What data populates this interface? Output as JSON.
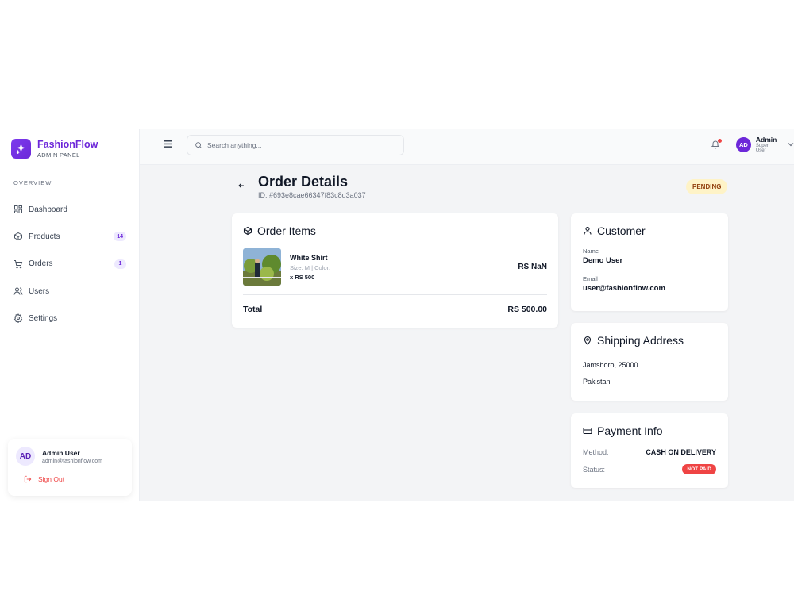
{
  "brand": {
    "name": "FashionFlow",
    "subtitle": "ADMIN PANEL",
    "icon": "sparkles-icon"
  },
  "sidebar": {
    "section": "OVERVIEW",
    "items": [
      {
        "label": "Dashboard",
        "icon": "grid-icon",
        "badge": ""
      },
      {
        "label": "Products",
        "icon": "box-icon",
        "badge": "14"
      },
      {
        "label": "Orders",
        "icon": "cart-icon",
        "badge": "1"
      },
      {
        "label": "Users",
        "icon": "users-icon",
        "badge": ""
      },
      {
        "label": "Settings",
        "icon": "gear-icon",
        "badge": ""
      }
    ],
    "user": {
      "initials": "AD",
      "name": "Admin User",
      "email": "admin@fashionflow.com",
      "signout": "Sign Out"
    }
  },
  "topbar": {
    "search_placeholder": "Search anything...",
    "profile": {
      "initials": "AD",
      "name": "Admin",
      "role": "Super User"
    }
  },
  "order": {
    "title": "Order Details",
    "id_text": "ID: #693e8cae66347f83c8d3a037",
    "status": "PENDING",
    "items_title": "Order Items",
    "items": [
      {
        "name": "White Shirt",
        "meta": "Size: M | Color:",
        "qty": "x RS 500",
        "price": "RS NaN"
      }
    ],
    "total_label": "Total",
    "total_value": "RS 500.00"
  },
  "customer": {
    "title": "Customer",
    "name_label": "Name",
    "name": "Demo User",
    "email_label": "Email",
    "email": "user@fashionflow.com"
  },
  "shipping": {
    "title": "Shipping Address",
    "line1": "Jamshoro, 25000",
    "line2": "Pakistan"
  },
  "payment": {
    "title": "Payment Info",
    "method_label": "Method:",
    "method": "CASH ON DELIVERY",
    "status_label": "Status:",
    "status": "NOT PAID"
  },
  "colors": {
    "accent": "#6d28d9",
    "danger": "#ef4444",
    "pending_bg": "#fef3c7"
  }
}
